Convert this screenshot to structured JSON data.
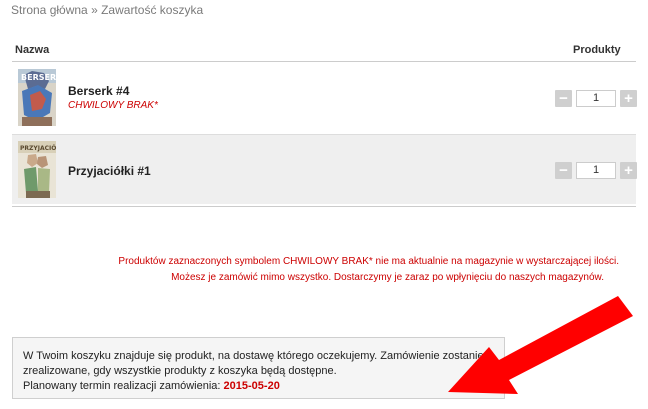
{
  "breadcrumb": {
    "home": "Strona główna",
    "separator": "»",
    "current": "Zawartość koszyka"
  },
  "table": {
    "col_name": "Nazwa",
    "col_products": "Produkty"
  },
  "items": [
    {
      "name": "Berserk #4",
      "status": "CHWILOWY BRAK*",
      "quantity": "1"
    },
    {
      "name": "Przyjaciółki #1",
      "status": "",
      "quantity": "1"
    }
  ],
  "notice": {
    "line1": "Produktów zaznaczonych symbolem CHWILOWY BRAK* nie ma aktualnie na magazynie w wystarczającej ilości.",
    "line2": "Możesz je zamówić mimo wszystko. Dostarczymy je zaraz po wpłynięciu do naszych magazynów."
  },
  "info": {
    "text": "W Twoim koszyku znajduje się produkt, na dostawę którego oczekujemy. Zamówienie zostanie zrealizowane, gdy wszystkie produkty z koszyka będą dostępne.",
    "planned_label": "Planowany termin realizacji zamówienia:",
    "planned_date": "2015-05-20"
  },
  "controls": {
    "minus": "−",
    "plus": "+"
  },
  "colors": {
    "accent_red": "#cc0000",
    "arrow_red": "#ff0000"
  }
}
